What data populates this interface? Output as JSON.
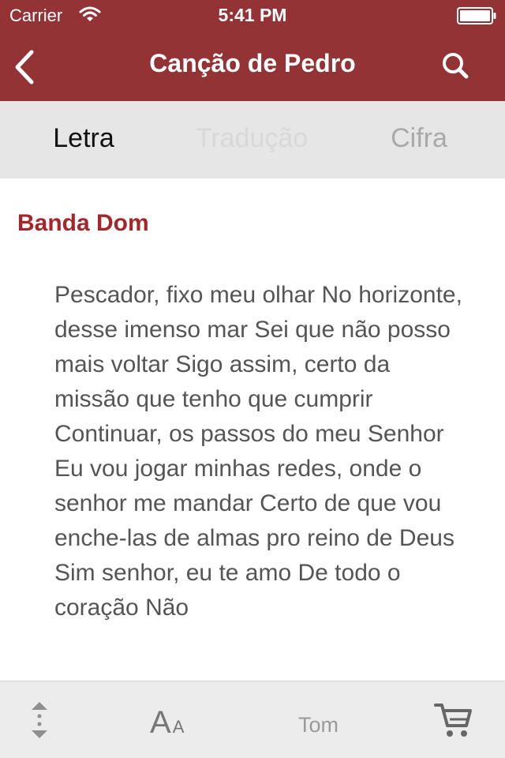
{
  "status_bar": {
    "carrier": "Carrier",
    "time": "5:41 PM"
  },
  "nav": {
    "title": "Canção de Pedro",
    "back_icon": "chevron-left-icon",
    "search_icon": "search-icon"
  },
  "tabs": [
    {
      "label": "Letra"
    },
    {
      "label": "Tradução"
    },
    {
      "label": "Cifra"
    }
  ],
  "song": {
    "artist": "Banda Dom",
    "lyrics": "Pescador, fixo meu olhar No horizonte, desse imenso mar Sei que não posso mais voltar Sigo assim, certo da missão que tenho que cumprir Continuar, os passos do meu Senhor Eu vou jogar minhas redes, onde o senhor me mandar Certo de que vou enche-las de almas pro reino de Deus Sim senhor, eu te amo De todo o coração Não"
  },
  "toolbar": {
    "font_big": "A",
    "font_small": "A",
    "tom_label": "Tom",
    "scroll_icon": "up-down-arrows-icon",
    "cart_icon": "cart-icon"
  },
  "colors": {
    "header_bg": "#933335",
    "accent_text": "#a5262a",
    "tabs_bg": "#e6e6e6",
    "toolbar_bg": "#ececec"
  }
}
